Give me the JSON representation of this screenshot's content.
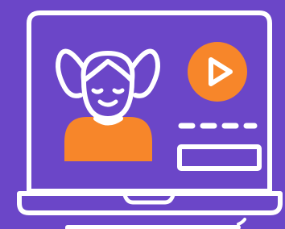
{
  "illustration": {
    "subject": "laptop-video-lesson",
    "icons": [
      "laptop-icon",
      "girl-avatar-icon",
      "play-button-icon",
      "progress-dots-icon",
      "text-field-icon"
    ]
  },
  "colors": {
    "background": "#6b46c8",
    "outline": "#ffffff",
    "accent": "#f7862a"
  }
}
